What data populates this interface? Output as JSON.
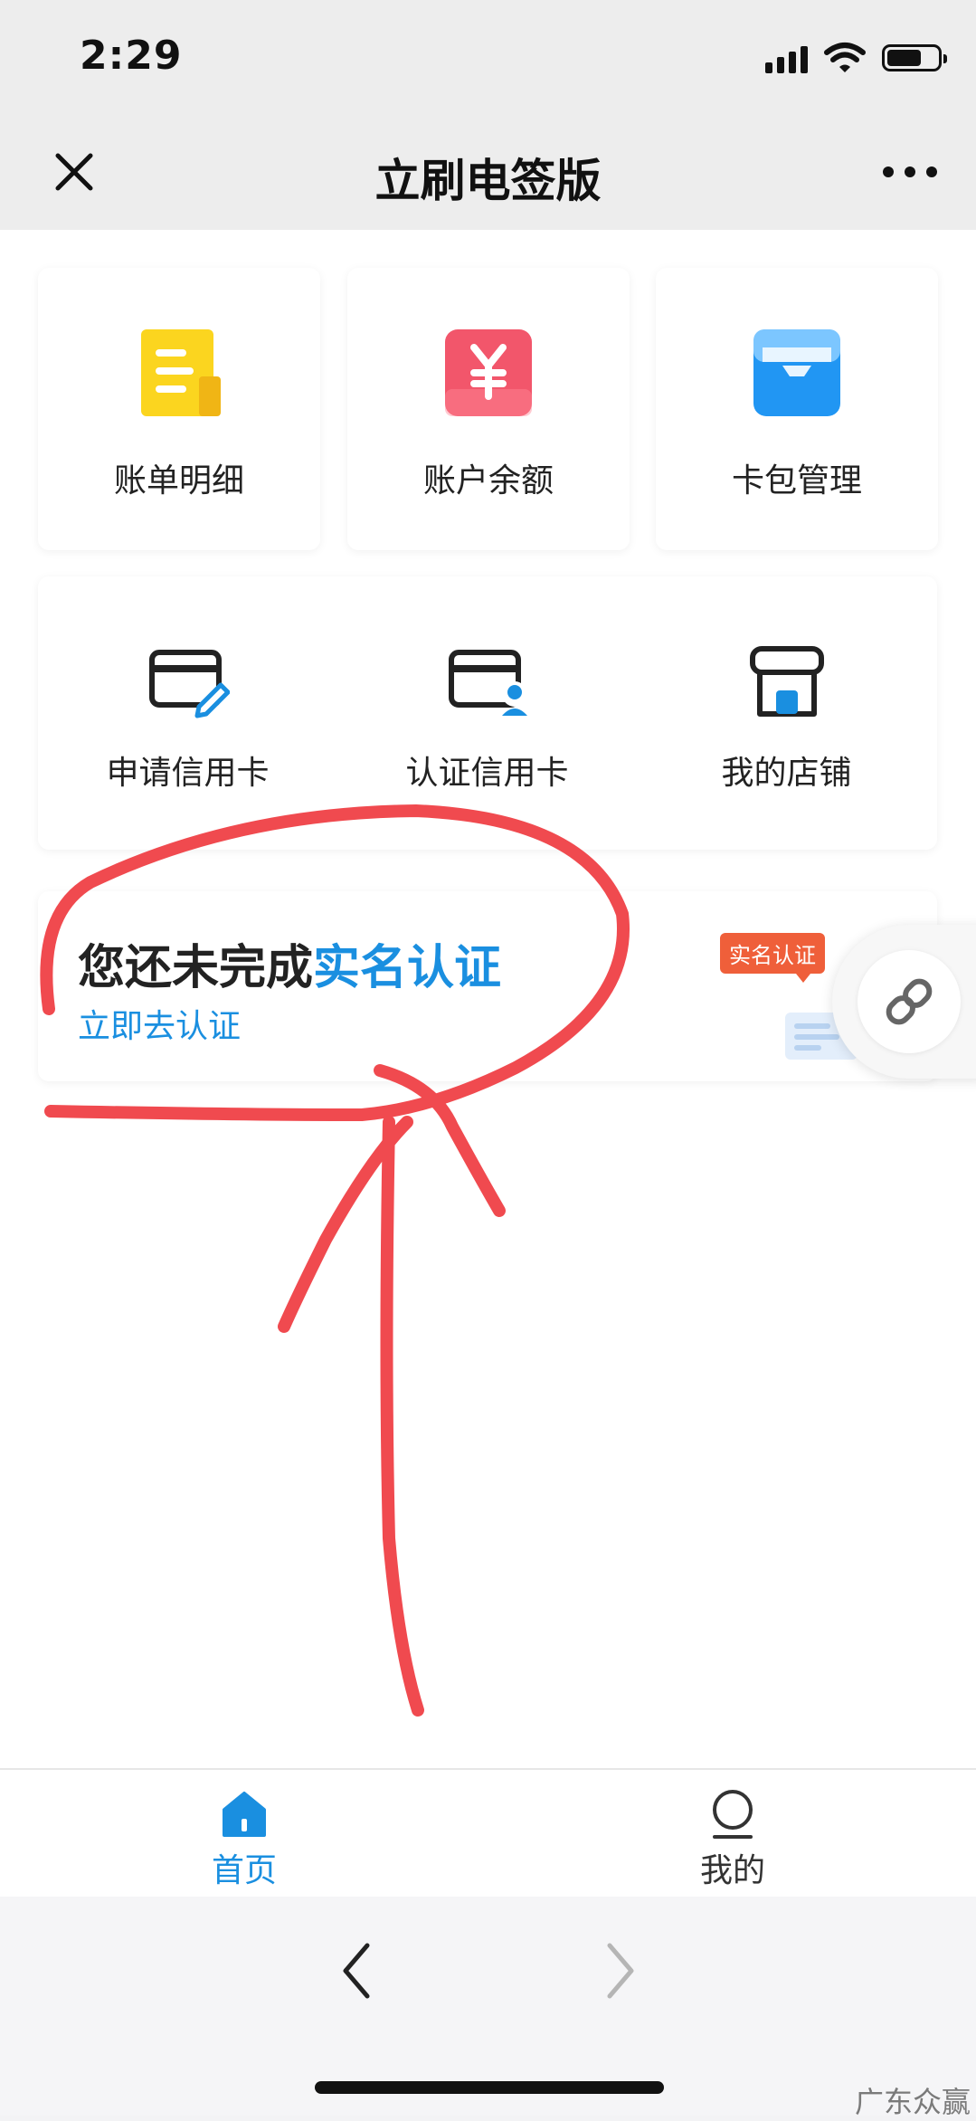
{
  "status_bar": {
    "time": "2:29",
    "icons": [
      "signal-icon",
      "wifi-icon",
      "battery-icon"
    ]
  },
  "nav_bar": {
    "title": "立刷电签版",
    "close_icon": "close-icon",
    "more_icon": "more-icon"
  },
  "grid_top": [
    {
      "label": "账单明细",
      "icon": "bill-detail-icon",
      "color": "#f8d41e"
    },
    {
      "label": "账户余额",
      "icon": "yuan-balance-icon",
      "color": "#f2566b"
    },
    {
      "label": "卡包管理",
      "icon": "card-wallet-icon",
      "color": "#2196f3"
    }
  ],
  "grid_services": [
    {
      "label": "申请信用卡",
      "icon": "card-apply-icon"
    },
    {
      "label": "认证信用卡",
      "icon": "card-verify-icon"
    },
    {
      "label": "我的店铺",
      "icon": "shop-icon"
    }
  ],
  "verify_banner": {
    "title_prefix": "您还未完成",
    "title_highlight": "实名认证",
    "link": "立即去认证",
    "badge": "实名认证"
  },
  "floating_button": {
    "icon": "link-icon"
  },
  "tab_bar": {
    "tabs": [
      {
        "label": "首页",
        "icon": "home-icon",
        "active": true
      },
      {
        "label": "我的",
        "icon": "profile-icon",
        "active": false
      }
    ]
  },
  "browser_nav": {
    "back_icon": "chevron-left-icon",
    "forward_icon": "chevron-right-icon"
  },
  "watermark": "广东众赢",
  "colors": {
    "accent": "#1a8fe0",
    "annotation": "#f04a4f",
    "badge": "#ef5f3a"
  }
}
